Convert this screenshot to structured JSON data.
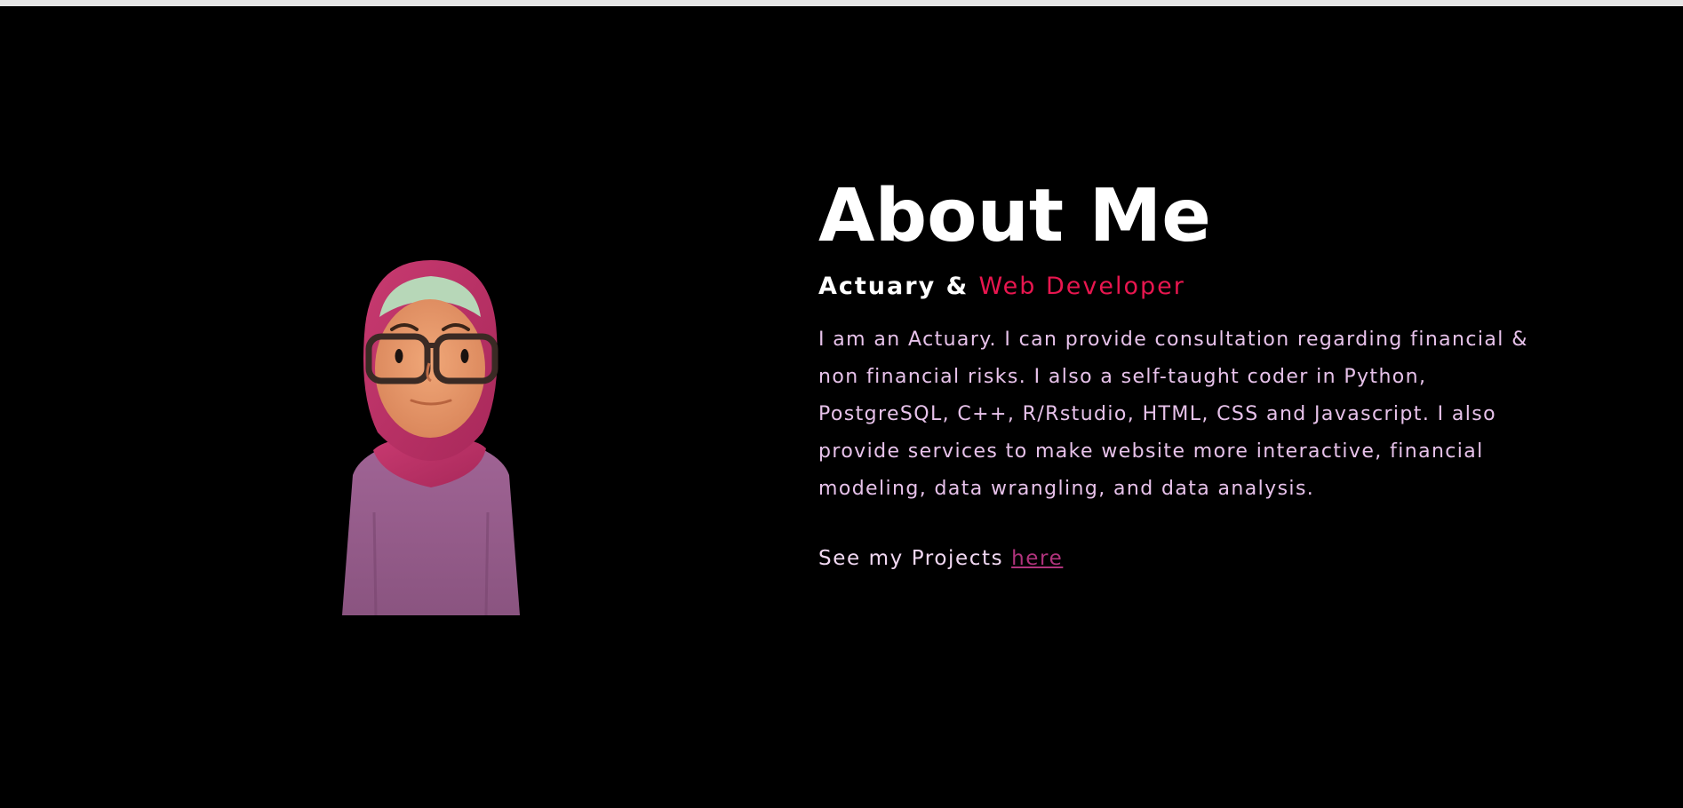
{
  "about": {
    "title": "About Me",
    "subtitle_lead": "Actuary & ",
    "subtitle_accent": "Web Developer",
    "body": "I am an Actuary. I can provide consultation regarding financial & non financial risks. I also a self-taught coder in Python, PostgreSQL, C++, R/Rstudio, HTML, CSS and Javascript. I also provide services to make website more interactive, financial modeling, data wrangling, and data analysis.",
    "projects_prefix": "See my Projects ",
    "projects_link": "here"
  },
  "colors": {
    "background": "#000000",
    "accent": "#e8164f",
    "body_text": "#e7c2ea",
    "link": "#b0337c"
  }
}
